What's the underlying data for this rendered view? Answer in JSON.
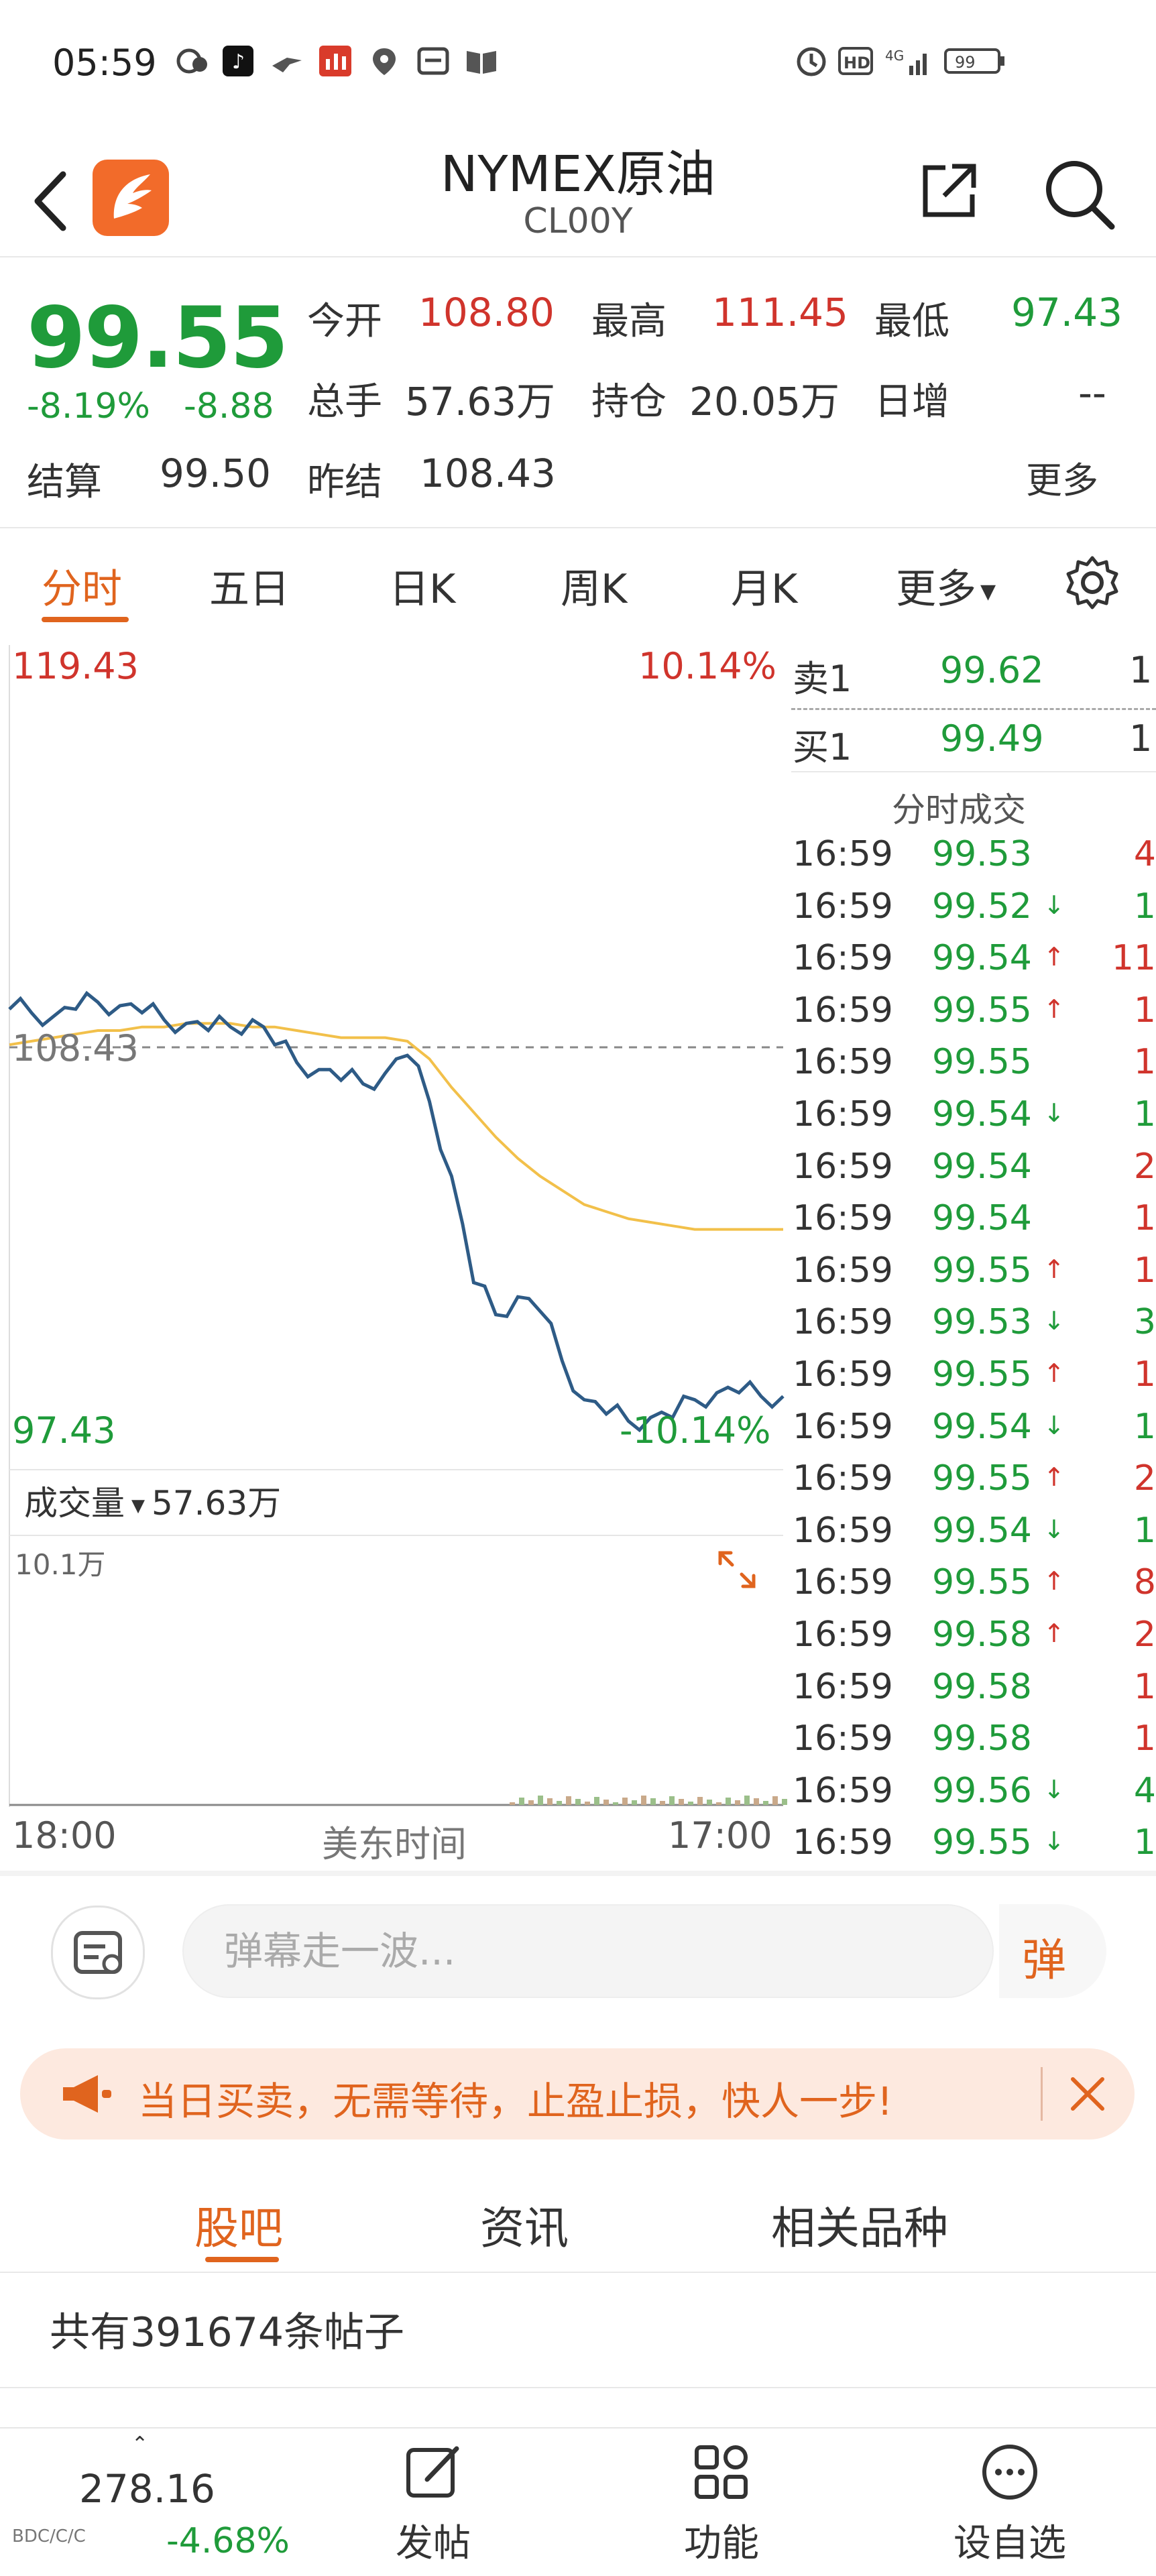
{
  "status_bar": {
    "time": "05:59",
    "battery": "99"
  },
  "header": {
    "title": "NYMEX原油",
    "code": "CL00Y"
  },
  "quote": {
    "price": "99.55",
    "change_pct": "-8.19%",
    "change": "-8.88",
    "stats": [
      {
        "label": "今开",
        "value": "108.80"
      },
      {
        "label": "最高",
        "value": "111.45"
      },
      {
        "label": "最低",
        "value": "97.43"
      },
      {
        "label": "总手",
        "value": "57.63万"
      },
      {
        "label": "持仓",
        "value": "20.05万"
      },
      {
        "label": "日增",
        "value": "--"
      },
      {
        "label": "结算",
        "value": "99.50"
      },
      {
        "label": "昨结",
        "value": "108.43"
      }
    ],
    "more": "更多"
  },
  "tabs": [
    "分时",
    "五日",
    "日K",
    "周K",
    "月K",
    "更多"
  ],
  "chart": {
    "price_top": "119.43",
    "pct_top": "10.14%",
    "prev_settle": "108.43",
    "price_bottom": "97.43",
    "pct_bottom": "-10.14%",
    "volume_label": "成交量",
    "volume_total": "57.63万",
    "volume_max": "10.1万",
    "time_start": "18:00",
    "time_zone": "美东时间",
    "time_end": "17:00"
  },
  "chart_data": {
    "type": "line",
    "ylim": [
      97.43,
      119.43
    ],
    "prev_close": 108.43,
    "series": [
      {
        "values": [
          109.7,
          109.6,
          109.5,
          109.7,
          109.9,
          109.8,
          109.6,
          109.4,
          109.3,
          109.1,
          109.2,
          109.4,
          108.7,
          108.2,
          108.0,
          107.7,
          107.6,
          107.9,
          108.4,
          107.1,
          105.0,
          102.0,
          101.1,
          101.6,
          101.2,
          99.8,
          98.7,
          98.3,
          98.1,
          98.2,
          98.2,
          98.7,
          98.9,
          98.9,
          98.8,
          98.8
        ]
      },
      {
        "values": [
          108.7,
          108.8,
          108.9,
          109.0,
          109.1,
          109.1,
          109.2,
          109.2,
          109.3,
          109.3,
          109.3,
          109.2,
          109.2,
          109.1,
          109.0,
          108.9,
          108.9,
          108.9,
          108.8,
          108.3,
          107.5,
          106.8,
          106.1,
          105.5,
          105.0,
          104.6,
          104.2,
          104.0,
          103.8,
          103.7,
          103.6,
          103.5,
          103.5,
          103.5,
          103.5,
          103.5
        ]
      }
    ]
  },
  "order_book": {
    "ask": {
      "label": "卖1",
      "price": "99.62",
      "qty": "1"
    },
    "bid": {
      "label": "买1",
      "price": "99.49",
      "qty": "1"
    },
    "trades_title": "分时成交"
  },
  "trades": [
    {
      "time": "16:59",
      "price": "99.53",
      "dir": "",
      "qty": "4"
    },
    {
      "time": "16:59",
      "price": "99.52",
      "dir": "down",
      "qty": "1"
    },
    {
      "time": "16:59",
      "price": "99.54",
      "dir": "up",
      "qty": "11"
    },
    {
      "time": "16:59",
      "price": "99.55",
      "dir": "up",
      "qty": "1"
    },
    {
      "time": "16:59",
      "price": "99.55",
      "dir": "",
      "qty": "1"
    },
    {
      "time": "16:59",
      "price": "99.54",
      "dir": "down",
      "qty": "1"
    },
    {
      "time": "16:59",
      "price": "99.54",
      "dir": "",
      "qty": "2"
    },
    {
      "time": "16:59",
      "price": "99.54",
      "dir": "",
      "qty": "1"
    },
    {
      "time": "16:59",
      "price": "99.55",
      "dir": "up",
      "qty": "1"
    },
    {
      "time": "16:59",
      "price": "99.53",
      "dir": "down",
      "qty": "3"
    },
    {
      "time": "16:59",
      "price": "99.55",
      "dir": "up",
      "qty": "1"
    },
    {
      "time": "16:59",
      "price": "99.54",
      "dir": "down",
      "qty": "1"
    },
    {
      "time": "16:59",
      "price": "99.55",
      "dir": "up",
      "qty": "2"
    },
    {
      "time": "16:59",
      "price": "99.54",
      "dir": "down",
      "qty": "1"
    },
    {
      "time": "16:59",
      "price": "99.55",
      "dir": "up",
      "qty": "8"
    },
    {
      "time": "16:59",
      "price": "99.58",
      "dir": "up",
      "qty": "2"
    },
    {
      "time": "16:59",
      "price": "99.58",
      "dir": "",
      "qty": "1"
    },
    {
      "time": "16:59",
      "price": "99.58",
      "dir": "",
      "qty": "1"
    },
    {
      "time": "16:59",
      "price": "99.56",
      "dir": "down",
      "qty": "4"
    },
    {
      "time": "16:59",
      "price": "99.55",
      "dir": "down",
      "qty": "1"
    }
  ],
  "danmaku": {
    "placeholder": "弹幕走一波...",
    "send": "弹"
  },
  "promo": {
    "text": "当日买卖，无需等待，止盈止损，快人一步!"
  },
  "subtabs": [
    "股吧",
    "资讯",
    "相关品种"
  ],
  "posts": {
    "count_text": "共有391674条帖子"
  },
  "bottom_nav": {
    "index_value": "278.16",
    "index_change": "-4.68%",
    "items": [
      "发帖",
      "功能",
      "设自选"
    ]
  },
  "colors": {
    "up": "#d0342c",
    "down": "#1f9b3a",
    "accent": "#e0641e",
    "price_line": "#2e5b86",
    "avg_line": "#f2c04a"
  }
}
